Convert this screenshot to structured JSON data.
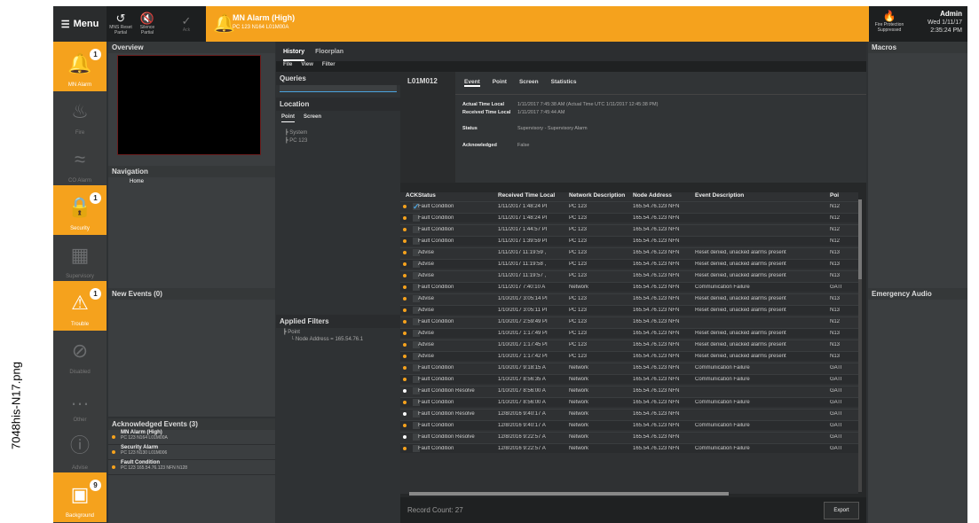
{
  "side_caption": "7048his-N17.png",
  "menu": {
    "label": "Menu"
  },
  "toolbar": [
    {
      "label": "MNS Reset Partial"
    },
    {
      "label": "Silence Partial"
    },
    {
      "label": "Ack"
    }
  ],
  "alarm": {
    "title": "MN Alarm (High)",
    "sub": "PC 123 N164 L01M00A"
  },
  "fire_protection": "Fire Protection Suppressed",
  "user": {
    "name": "Admin",
    "date": "Wed 1/11/17",
    "time": "2:35:24 PM"
  },
  "left_nav": [
    {
      "label": "MN Alarm",
      "badge": "1",
      "active": true,
      "icon": "bell-icon"
    },
    {
      "label": "Fire",
      "badge": "",
      "active": false,
      "icon": "flame-icon"
    },
    {
      "label": "CO Alarm",
      "badge": "",
      "active": false,
      "icon": "waves-icon"
    },
    {
      "label": "Security",
      "badge": "1",
      "active": true,
      "icon": "lock-icon"
    },
    {
      "label": "Supervisory",
      "badge": "",
      "active": false,
      "icon": "grid-icon"
    },
    {
      "label": "Trouble",
      "badge": "1",
      "active": true,
      "icon": "warning-icon"
    },
    {
      "label": "Disabled",
      "badge": "",
      "active": false,
      "icon": "disabled-icon"
    },
    {
      "label": "Other",
      "badge": "",
      "active": false,
      "icon": "dots-icon"
    },
    {
      "label": "Advise",
      "badge": "",
      "active": false,
      "icon": "info-icon"
    },
    {
      "label": "Background",
      "badge": "9",
      "active": true,
      "icon": "background-icon"
    }
  ],
  "overview": {
    "title": "Overview"
  },
  "navigation": {
    "title": "Navigation",
    "item": "Home"
  },
  "new_events": {
    "title": "New Events (0)"
  },
  "ack_events": {
    "title": "Acknowledged Events (3)",
    "items": [
      {
        "name": "MN Alarm (High)",
        "detail": "PC 123 N164 L01M00A"
      },
      {
        "name": "Security Alarm",
        "detail": "PC 123 N130 L01M006"
      },
      {
        "name": "Fault Condition",
        "detail": "PC 123 165.54.76.123 NFN N128"
      }
    ]
  },
  "tabs": {
    "history": "History",
    "floorplan": "Floorplan"
  },
  "submenu": {
    "file": "File",
    "view": "View",
    "filter": "Filter"
  },
  "queries": {
    "title": "Queries"
  },
  "location": {
    "title": "Location",
    "tab_point": "Point",
    "tab_screen": "Screen",
    "tree": [
      "System",
      "PC 123"
    ]
  },
  "applied_filters": {
    "title": "Applied Filters",
    "point": "Point",
    "node": "Node Address = 165.54.76.1"
  },
  "detail": {
    "id": "L01M012",
    "tabs": [
      "Event",
      "Point",
      "Screen",
      "Statistics"
    ],
    "actual_label": "Actual Time Local",
    "actual_value": "1/11/2017 7:45:38 AM (Actual Time UTC 1/11/2017 12:45:38 PM)",
    "received_label": "Received Time Local",
    "received_value": "1/11/2017 7:45:44 AM",
    "status_label": "Status",
    "status_value": "Supervisory - Supervisory Alarm",
    "ack_label": "Acknowledged",
    "ack_value": "False"
  },
  "grid": {
    "headers": [
      "ACK",
      "Status",
      "Received Time Local",
      "Network Description",
      "Node Address",
      "Event Description",
      "Poi"
    ],
    "rows": [
      [
        "o",
        "Fault Condition",
        "1/11/2017 1:48:24 PI",
        "PC 123",
        "165.54.76.123 NFN",
        "",
        "N12"
      ],
      [
        "o",
        "Fault Condition",
        "1/11/2017 1:48:24 PI",
        "PC 123",
        "165.54.76.123 NFN",
        "",
        "N12"
      ],
      [
        "o",
        "Fault Condition",
        "1/11/2017 1:44:57 PI",
        "PC 123",
        "165.54.76.123 NFN",
        "",
        "N12"
      ],
      [
        "o",
        "Fault Condition",
        "1/11/2017 1:39:59 PI",
        "PC 123",
        "165.54.76.123 NFN",
        "",
        "N12"
      ],
      [
        "o",
        "Advise",
        "1/11/2017 11:19:59 ,",
        "PC 123",
        "165.54.76.123 NFN",
        "Reset denied, unacked alarms present",
        "N13"
      ],
      [
        "o",
        "Advise",
        "1/11/2017 11:19:58 ,",
        "PC 123",
        "165.54.76.123 NFN",
        "Reset denied, unacked alarms present",
        "N13"
      ],
      [
        "o",
        "Advise",
        "1/11/2017 11:19:57 ,",
        "PC 123",
        "165.54.76.123 NFN",
        "Reset denied, unacked alarms present",
        "N13"
      ],
      [
        "o",
        "Fault Condition",
        "1/11/2017 7:40:10 A",
        "Network",
        "165.54.76.123 NFN",
        "Communication Failure",
        "GATI"
      ],
      [
        "o",
        "Advise",
        "1/10/2017 3:05:14 PI",
        "PC 123",
        "165.54.76.123 NFN",
        "Reset denied, unacked alarms present",
        "N13"
      ],
      [
        "o",
        "Advise",
        "1/10/2017 3:05:11 PI",
        "PC 123",
        "165.54.76.123 NFN",
        "Reset denied, unacked alarms present",
        "N13"
      ],
      [
        "o",
        "Fault Condition",
        "1/10/2017 2:59:49 PI",
        "PC 123",
        "165.54.76.123 NFN",
        "",
        "N12"
      ],
      [
        "o",
        "Advise",
        "1/10/2017 1:17:49 PI",
        "PC 123",
        "165.54.76.123 NFN",
        "Reset denied, unacked alarms present",
        "N13"
      ],
      [
        "o",
        "Advise",
        "1/10/2017 1:17:45 PI",
        "PC 123",
        "165.54.76.123 NFN",
        "Reset denied, unacked alarms present",
        "N13"
      ],
      [
        "o",
        "Advise",
        "1/10/2017 1:17:42 PI",
        "PC 123",
        "165.54.76.123 NFN",
        "Reset denied, unacked alarms present",
        "N13"
      ],
      [
        "o",
        "Fault Condition",
        "1/10/2017 9:18:15 A",
        "Network",
        "165.54.76.123 NFN",
        "Communication Failure",
        "GATI"
      ],
      [
        "o",
        "Fault Condition",
        "1/10/2017 8:56:35 A",
        "Network",
        "165.54.76.123 NFN",
        "Communication Failure",
        "GATI"
      ],
      [
        "w",
        "Fault Condition Resolve",
        "1/10/2017 8:56:00 A",
        "Network",
        "165.54.76.123 NFN",
        "",
        "GATI"
      ],
      [
        "o",
        "Fault Condition",
        "1/10/2017 8:56:00 A",
        "Network",
        "165.54.76.123 NFN",
        "Communication Failure",
        "GATI"
      ],
      [
        "w",
        "Fault Condition Resolve",
        "12/8/2016 9:40:17 A",
        "Network",
        "165.54.76.123 NFN",
        "",
        "GATI"
      ],
      [
        "o",
        "Fault Condition",
        "12/8/2016 9:40:17 A",
        "Network",
        "165.54.76.123 NFN",
        "Communication Failure",
        "GATI"
      ],
      [
        "w",
        "Fault Condition Resolve",
        "12/8/2016 9:22:57 A",
        "Network",
        "165.54.76.123 NFN",
        "",
        "GATI"
      ],
      [
        "o",
        "Fault Condition",
        "12/8/2016 9:22:57 A",
        "Network",
        "165.54.76.123 NFN",
        "Communication Failure",
        "GATI"
      ]
    ]
  },
  "record_count": "Record Count: 27",
  "export": "Export",
  "macros": {
    "title": "Macros"
  },
  "emergency_audio": {
    "title": "Emergency Audio"
  }
}
